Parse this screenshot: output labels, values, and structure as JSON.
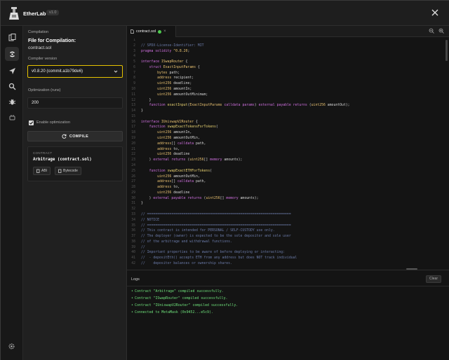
{
  "app": {
    "title": "EtherLab",
    "version": "v1.0"
  },
  "sidebar_panel": {
    "section_label": "Compilation",
    "heading": "File for Compilation:",
    "file": "contract.sol",
    "compiler_label": "Compiler version",
    "compiler_value": "v0.8.20 (commit.a1b79de6)",
    "optimization_label": "Optimization (runs)",
    "optimization_value": "200",
    "enable_optimization_label": "Enable optimization",
    "enable_optimization_checked": true,
    "compile_label": "COMPILE",
    "contract_card": {
      "label": "CONTRACT",
      "name": "Arbitrage (contract.sol)",
      "abi_label": "ABI",
      "bytecode_label": "Bytecode"
    }
  },
  "editor": {
    "tab": {
      "file": "contract.sol",
      "status_color": "#4ec94e"
    },
    "lines": [
      {
        "n": "1",
        "t": [
          {
            "c": "",
            "s": ""
          }
        ]
      },
      {
        "n": "2",
        "t": [
          {
            "c": "cm",
            "s": "// SPDX-License-Identifier: MIT"
          }
        ]
      },
      {
        "n": "3",
        "t": [
          {
            "c": "kw",
            "s": "pragma"
          },
          {
            "c": "id",
            "s": " "
          },
          {
            "c": "kw",
            "s": "solidity"
          },
          {
            "c": "id",
            "s": " "
          },
          {
            "c": "ty",
            "s": "^0.8.20"
          },
          {
            "c": "id",
            "s": ";"
          }
        ]
      },
      {
        "n": "4",
        "t": [
          {
            "c": "",
            "s": ""
          }
        ]
      },
      {
        "n": "5",
        "t": [
          {
            "c": "kw",
            "s": "interface"
          },
          {
            "c": "id",
            "s": " "
          },
          {
            "c": "ty",
            "s": "ISwapRouter"
          },
          {
            "c": "id",
            "s": " {"
          }
        ]
      },
      {
        "n": "6",
        "t": [
          {
            "c": "id",
            "s": "    "
          },
          {
            "c": "kw",
            "s": "struct"
          },
          {
            "c": "id",
            "s": " "
          },
          {
            "c": "ty",
            "s": "ExactInputParams"
          },
          {
            "c": "id",
            "s": " {"
          }
        ]
      },
      {
        "n": "7",
        "t": [
          {
            "c": "id",
            "s": "        "
          },
          {
            "c": "ty",
            "s": "bytes"
          },
          {
            "c": "id",
            "s": " path;"
          }
        ]
      },
      {
        "n": "8",
        "t": [
          {
            "c": "id",
            "s": "        "
          },
          {
            "c": "ty",
            "s": "address"
          },
          {
            "c": "id",
            "s": " recipient;"
          }
        ]
      },
      {
        "n": "9",
        "t": [
          {
            "c": "id",
            "s": "        "
          },
          {
            "c": "ty",
            "s": "uint256"
          },
          {
            "c": "id",
            "s": " deadline;"
          }
        ]
      },
      {
        "n": "10",
        "t": [
          {
            "c": "id",
            "s": "        "
          },
          {
            "c": "ty",
            "s": "uint256"
          },
          {
            "c": "id",
            "s": " amountIn;"
          }
        ]
      },
      {
        "n": "11",
        "t": [
          {
            "c": "id",
            "s": "        "
          },
          {
            "c": "ty",
            "s": "uint256"
          },
          {
            "c": "id",
            "s": " amountOutMinimum;"
          }
        ]
      },
      {
        "n": "12",
        "t": [
          {
            "c": "id",
            "s": "    }"
          }
        ]
      },
      {
        "n": "13",
        "t": [
          {
            "c": "id",
            "s": "    "
          },
          {
            "c": "kw",
            "s": "function"
          },
          {
            "c": "id",
            "s": " "
          },
          {
            "c": "fn",
            "s": "exactInput"
          },
          {
            "c": "id",
            "s": "("
          },
          {
            "c": "ty",
            "s": "ExactInputParams"
          },
          {
            "c": "id",
            "s": " "
          },
          {
            "c": "kw",
            "s": "calldata"
          },
          {
            "c": "id",
            "s": " "
          },
          {
            "c": "kw",
            "s": "params"
          },
          {
            "c": "id",
            "s": ") "
          },
          {
            "c": "kw",
            "s": "external"
          },
          {
            "c": "id",
            "s": " "
          },
          {
            "c": "kw",
            "s": "payable"
          },
          {
            "c": "id",
            "s": " "
          },
          {
            "c": "kw",
            "s": "returns"
          },
          {
            "c": "id",
            "s": " ("
          },
          {
            "c": "ty",
            "s": "uint256"
          },
          {
            "c": "id",
            "s": " amountOut);"
          }
        ]
      },
      {
        "n": "14",
        "t": [
          {
            "c": "id",
            "s": "}"
          }
        ]
      },
      {
        "n": "15",
        "t": [
          {
            "c": "",
            "s": ""
          }
        ]
      },
      {
        "n": "16",
        "t": [
          {
            "c": "kw",
            "s": "interface"
          },
          {
            "c": "id",
            "s": " "
          },
          {
            "c": "ty",
            "s": "IUniswapV2Router"
          },
          {
            "c": "id",
            "s": " {"
          }
        ]
      },
      {
        "n": "17",
        "t": [
          {
            "c": "id",
            "s": "    "
          },
          {
            "c": "kw",
            "s": "function"
          },
          {
            "c": "id",
            "s": " "
          },
          {
            "c": "fn",
            "s": "swapExactTokensForTokens"
          },
          {
            "c": "id",
            "s": "("
          }
        ]
      },
      {
        "n": "18",
        "t": [
          {
            "c": "id",
            "s": "        "
          },
          {
            "c": "ty",
            "s": "uint256"
          },
          {
            "c": "id",
            "s": " amountIn,"
          }
        ]
      },
      {
        "n": "19",
        "t": [
          {
            "c": "id",
            "s": "        "
          },
          {
            "c": "ty",
            "s": "uint256"
          },
          {
            "c": "id",
            "s": " amountOutMin,"
          }
        ]
      },
      {
        "n": "20",
        "t": [
          {
            "c": "id",
            "s": "        "
          },
          {
            "c": "ty",
            "s": "address"
          },
          {
            "c": "id",
            "s": "[] "
          },
          {
            "c": "kw",
            "s": "calldata"
          },
          {
            "c": "id",
            "s": " path,"
          }
        ]
      },
      {
        "n": "21",
        "t": [
          {
            "c": "id",
            "s": "        "
          },
          {
            "c": "ty",
            "s": "address"
          },
          {
            "c": "id",
            "s": " to,"
          }
        ]
      },
      {
        "n": "22",
        "t": [
          {
            "c": "id",
            "s": "        "
          },
          {
            "c": "ty",
            "s": "uint256"
          },
          {
            "c": "id",
            "s": " deadline"
          }
        ]
      },
      {
        "n": "23",
        "t": [
          {
            "c": "id",
            "s": "    ) "
          },
          {
            "c": "kw",
            "s": "external"
          },
          {
            "c": "id",
            "s": " "
          },
          {
            "c": "kw",
            "s": "returns"
          },
          {
            "c": "id",
            "s": " ("
          },
          {
            "c": "ty",
            "s": "uint256"
          },
          {
            "c": "id",
            "s": "[] "
          },
          {
            "c": "kw",
            "s": "memory"
          },
          {
            "c": "id",
            "s": " amounts);"
          }
        ]
      },
      {
        "n": "24",
        "t": [
          {
            "c": "",
            "s": ""
          }
        ]
      },
      {
        "n": "25",
        "t": [
          {
            "c": "id",
            "s": "    "
          },
          {
            "c": "kw",
            "s": "function"
          },
          {
            "c": "id",
            "s": " "
          },
          {
            "c": "fn",
            "s": "swapExactETHForTokens"
          },
          {
            "c": "id",
            "s": "("
          }
        ]
      },
      {
        "n": "26",
        "t": [
          {
            "c": "id",
            "s": "        "
          },
          {
            "c": "ty",
            "s": "uint256"
          },
          {
            "c": "id",
            "s": " amountOutMin,"
          }
        ]
      },
      {
        "n": "27",
        "t": [
          {
            "c": "id",
            "s": "        "
          },
          {
            "c": "ty",
            "s": "address"
          },
          {
            "c": "id",
            "s": "[] "
          },
          {
            "c": "kw",
            "s": "calldata"
          },
          {
            "c": "id",
            "s": " path,"
          }
        ]
      },
      {
        "n": "28",
        "t": [
          {
            "c": "id",
            "s": "        "
          },
          {
            "c": "ty",
            "s": "address"
          },
          {
            "c": "id",
            "s": " to,"
          }
        ]
      },
      {
        "n": "29",
        "t": [
          {
            "c": "id",
            "s": "        "
          },
          {
            "c": "ty",
            "s": "uint256"
          },
          {
            "c": "id",
            "s": " deadline"
          }
        ]
      },
      {
        "n": "30",
        "t": [
          {
            "c": "id",
            "s": "    ) "
          },
          {
            "c": "kw",
            "s": "external"
          },
          {
            "c": "id",
            "s": " "
          },
          {
            "c": "kw",
            "s": "payable"
          },
          {
            "c": "id",
            "s": " "
          },
          {
            "c": "kw",
            "s": "returns"
          },
          {
            "c": "id",
            "s": " ("
          },
          {
            "c": "ty",
            "s": "uint256"
          },
          {
            "c": "id",
            "s": "[] "
          },
          {
            "c": "kw",
            "s": "memory"
          },
          {
            "c": "id",
            "s": " amounts);"
          }
        ]
      },
      {
        "n": "31",
        "t": [
          {
            "c": "id",
            "s": "}"
          }
        ]
      },
      {
        "n": "32",
        "t": [
          {
            "c": "",
            "s": ""
          }
        ]
      },
      {
        "n": "33",
        "t": [
          {
            "c": "cm",
            "s": "// ======================================================================="
          }
        ]
      },
      {
        "n": "34",
        "t": [
          {
            "c": "cm",
            "s": "// NOTICE"
          }
        ]
      },
      {
        "n": "35",
        "t": [
          {
            "c": "cm",
            "s": "// ======================================================================="
          }
        ]
      },
      {
        "n": "36",
        "t": [
          {
            "c": "cm",
            "s": "// This contract is intended for PERSONAL / SELF-CUSTODY use only."
          }
        ]
      },
      {
        "n": "37",
        "t": [
          {
            "c": "cm",
            "s": "// The deployer (owner) is expected to be the sole depositor and sole user"
          }
        ]
      },
      {
        "n": "38",
        "t": [
          {
            "c": "cm",
            "s": "// of the arbitrage and withdrawal functions."
          }
        ]
      },
      {
        "n": "39",
        "t": [
          {
            "c": "cm",
            "s": "//"
          }
        ]
      },
      {
        "n": "40",
        "t": [
          {
            "c": "cm",
            "s": "// Important properties to be aware of before deploying or interacting:"
          }
        ]
      },
      {
        "n": "41",
        "t": [
          {
            "c": "cm",
            "s": "//  - depositEth() accepts ETH from any address but does NOT track individual"
          }
        ]
      },
      {
        "n": "42",
        "t": [
          {
            "c": "cm",
            "s": "//    depositor balances or ownership shares."
          }
        ]
      }
    ]
  },
  "logs": {
    "title": "Logs",
    "clear_label": "Clear",
    "entries": [
      "Contract \"Arbitrage\" compiled successfully.",
      "Contract \"ISwapRouter\" compiled successfully.",
      "Contract \"IUniswapV2Router\" compiled successfully.",
      "Connected to MetaMask (0x9452...e5c9)."
    ]
  },
  "colors": {
    "accent": "#e6c200",
    "success": "#6ee07a"
  }
}
